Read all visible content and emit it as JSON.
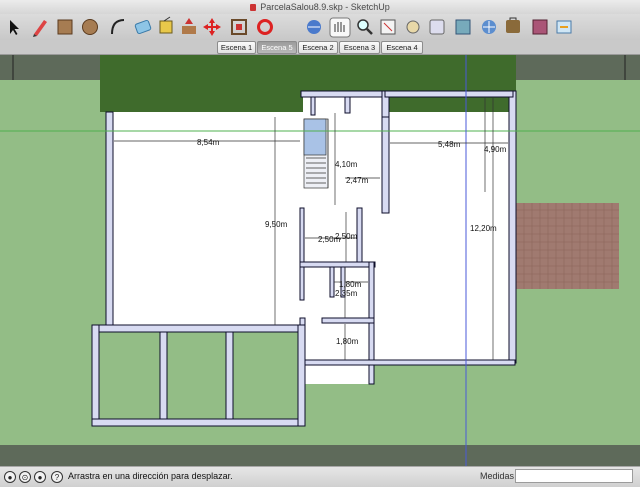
{
  "window": {
    "title": "ParcelaSalou8.9.skp - SketchUp"
  },
  "toolbar": {
    "tools": [
      "select-icon",
      "pencil-icon",
      "rectangle-icon",
      "circle-icon",
      "arc-icon",
      "eraser-icon",
      "paint-bucket-icon",
      "push-pull-icon",
      "move-icon",
      "rotate-icon",
      "offset-icon",
      "orbit-icon",
      "pan-icon",
      "zoom-icon",
      "zoom-extents-icon",
      "previous-view-icon",
      "next-view-icon",
      "components-icon",
      "get-models-icon",
      "share-icon"
    ]
  },
  "scenes": {
    "tabs": [
      {
        "label": "Escena 1",
        "active": false
      },
      {
        "label": "Escena 5",
        "active": true
      },
      {
        "label": "Escena 2",
        "active": false
      },
      {
        "label": "Escena 3",
        "active": false
      },
      {
        "label": "Escena 4",
        "active": false
      }
    ]
  },
  "model": {
    "dimensions": {
      "d854": "8,54m",
      "d548": "5,48m",
      "d490": "4,90m",
      "d410": "4,10m",
      "d247": "2,47m",
      "d950": "9,50m",
      "d1220": "12,20m",
      "d250a": "2,50m",
      "d250b": "2,50m",
      "d180a": "1,80m",
      "d235": "2,35m",
      "d180b": "1,80m"
    },
    "colors": {
      "grass": "#93bd86",
      "hedge": "#3f6b2c",
      "floor": "#ffffff",
      "wall": "#d8dbf2",
      "paving": "#a07a70"
    }
  },
  "status": {
    "hint": "Arrastra en una dirección para desplazar.",
    "measurements_label": "Medidas",
    "measurements_value": ""
  }
}
